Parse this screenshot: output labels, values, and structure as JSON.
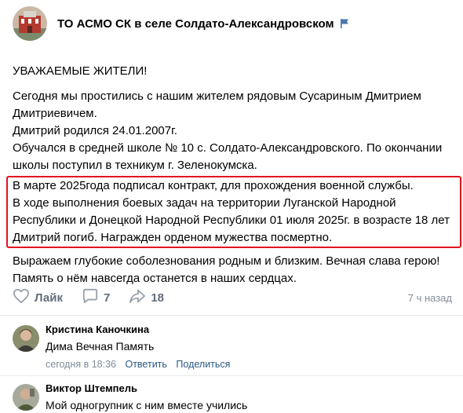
{
  "group": {
    "name": "ТО АСМО СК в селе Солдато-Александровском"
  },
  "post": {
    "heading": "УВАЖАЕМЫЕ ЖИТЕЛИ!",
    "p1": "Сегодня мы простились с нашим жителем рядовым Сусариным Дмитрием Дмитриевичем.",
    "p2": "Дмитрий родился 24.01.2007г.",
    "p3": "Обучался в средней школе № 10 с. Солдато-Александровского. По окончании школы поступил в техникум г. Зеленокумска.",
    "highlight1": "В марте 2025года подписал контракт, для прохождения военной службы.",
    "highlight2": "В ходе выполнения боевых задач на территории Луганской Народной Республики и Донецкой Народной Республики 01 июля 2025г. в возрасте 18 лет Дмитрий погиб. Награжден орденом мужества посмертно.",
    "closing": "Выражаем глубокие соболезнования родным и близким. Вечная слава герою! Память о нём навсегда останется в наших сердцах."
  },
  "actions": {
    "like_label": "Лайк",
    "comments_count": "7",
    "shares_count": "18",
    "time": "7 ч назад"
  },
  "comments": [
    {
      "author": "Кристина Каночкина",
      "text": "Дима Вечная Память",
      "time": "сегодня в 18:36",
      "reply": "Ответить",
      "share": "Поделиться"
    },
    {
      "author": "Виктор Штемпель",
      "text": "Мой одногрупник с ним вместе учились"
    }
  ],
  "colors": {
    "highlight_border": "#e0141f",
    "link": "#2a5885",
    "meta": "#818c99",
    "verified": "#4a76a8"
  }
}
